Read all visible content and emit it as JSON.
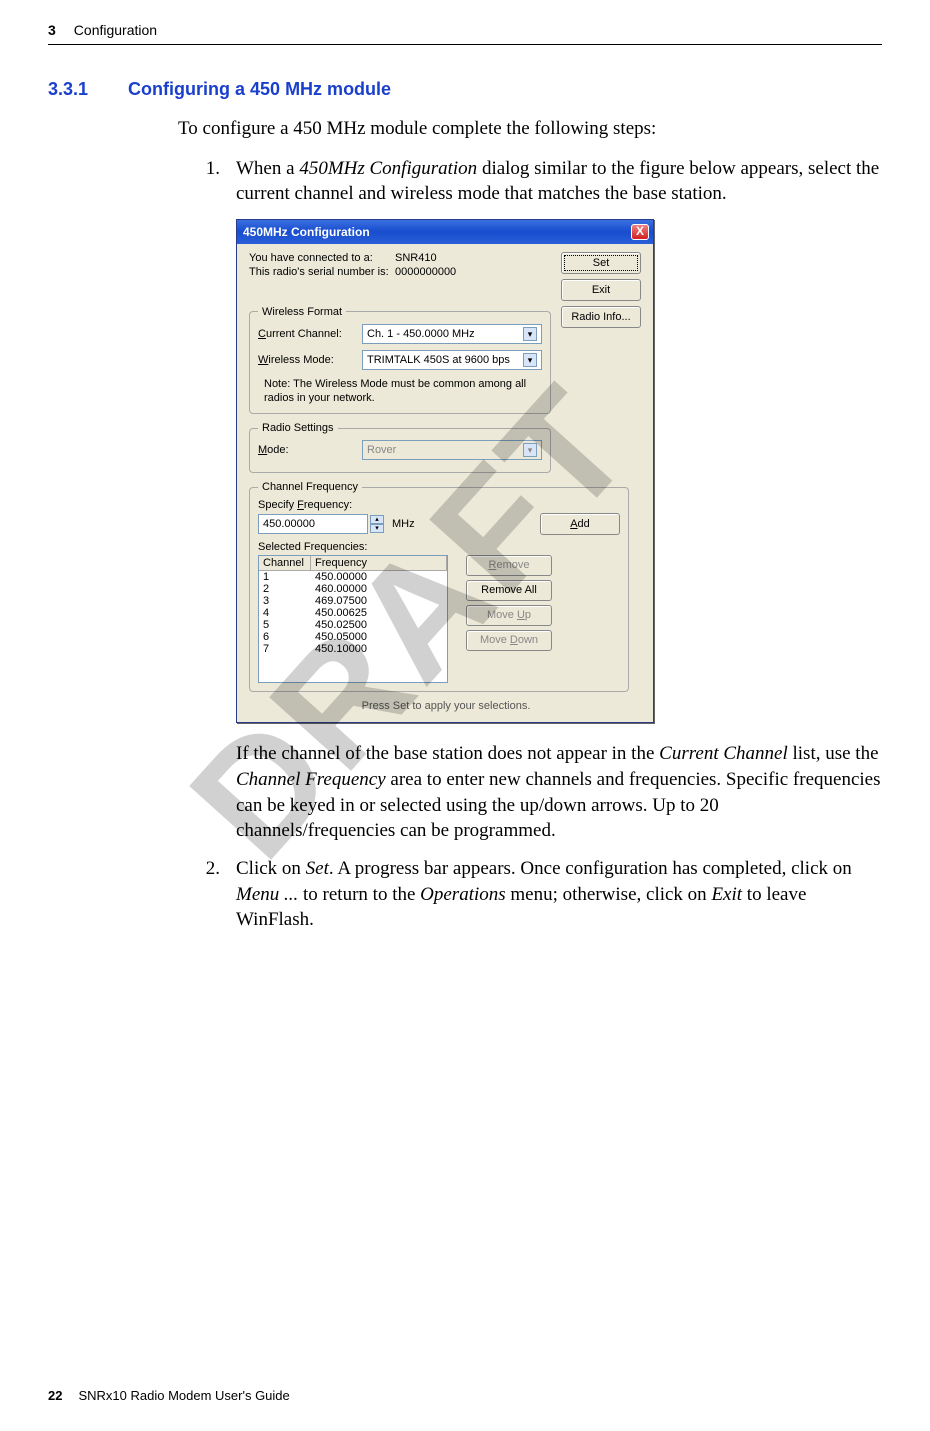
{
  "header": {
    "chapter_num": "3",
    "chapter_title": "Configuration"
  },
  "section": {
    "number": "3.3.1",
    "title": "Configuring a 450 MHz module"
  },
  "intro": "To configure a 450 MHz module complete the following steps:",
  "step1": {
    "num": "1.",
    "pre": "When a ",
    "ital": "450MHz Configuration",
    "post": " dialog similar to the figure below appears, select the current channel and wireless mode that matches the base station."
  },
  "dialog": {
    "title": "450MHz Configuration",
    "close": "X",
    "connected_lbl": "You have connected to a:",
    "connected_val": "SNR410",
    "serial_lbl": "This radio's serial number is:",
    "serial_val": "0000000000",
    "btn_set": "Set",
    "btn_exit": "Exit",
    "btn_radioinfo": "Radio Info...",
    "wf_legend": "Wireless Format",
    "curch_lbl_pre": "C",
    "curch_lbl_post": "urrent Channel:",
    "curch_val": "Ch.  1 - 450.0000 MHz",
    "wmode_lbl_pre": "W",
    "wmode_lbl_post": "ireless Mode:",
    "wmode_val": "TRIMTALK 450S at 9600 bps",
    "note": "Note: The Wireless Mode must be common among all radios in your network.",
    "rs_legend": "Radio Settings",
    "mode_lbl_pre": "M",
    "mode_lbl_post": "ode:",
    "mode_val": "Rover",
    "cf_legend": "Channel Frequency",
    "spec_lbl_pre": "Specify ",
    "spec_lbl_u": "F",
    "spec_lbl_post": "requency:",
    "spec_val": "450.00000",
    "mhz": "MHz",
    "btn_add_u": "A",
    "btn_add_post": "dd",
    "selfreq_lbl": "Selected Frequencies:",
    "col1": "Channel",
    "col2": "Frequency",
    "rows": [
      {
        "ch": "1",
        "freq": "450.00000"
      },
      {
        "ch": "2",
        "freq": "460.00000"
      },
      {
        "ch": "3",
        "freq": "469.07500"
      },
      {
        "ch": "4",
        "freq": "450.00625"
      },
      {
        "ch": "5",
        "freq": "450.02500"
      },
      {
        "ch": "6",
        "freq": "450.05000"
      },
      {
        "ch": "7",
        "freq": "450.10000"
      }
    ],
    "btn_remove_u": "R",
    "btn_remove_post": "emove",
    "btn_removeall": "Remove All",
    "btn_moveup_pre": "Move ",
    "btn_moveup_u": "U",
    "btn_moveup_post": "p",
    "btn_movedown_pre": "Move ",
    "btn_movedown_u": "D",
    "btn_movedown_post": "own",
    "press_set": "Press Set to apply your selections."
  },
  "after1": {
    "p1a": "If the channel of the base station does not appear in the ",
    "p1i1": "Current Channel",
    "p1b": " list, use the ",
    "p1i2": "Channel Frequency",
    "p1c": " area to enter new channels and frequencies. Specific frequencies can be keyed in or selected using the up/down arrows. Up to 20 channels/frequencies can be programmed."
  },
  "step2": {
    "num": "2.",
    "a": "Click on ",
    "i1": "Set",
    "b": ". A progress bar appears. Once configuration has completed, click on ",
    "i2": "Menu ...",
    "c": " to return to the ",
    "i3": "Operations",
    "d": " menu; otherwise, click on ",
    "i4": "Exit",
    "e": " to leave WinFlash."
  },
  "watermark": "DRAFT",
  "footer": {
    "page": "22",
    "title": "SNRx10 Radio Modem User's Guide"
  }
}
